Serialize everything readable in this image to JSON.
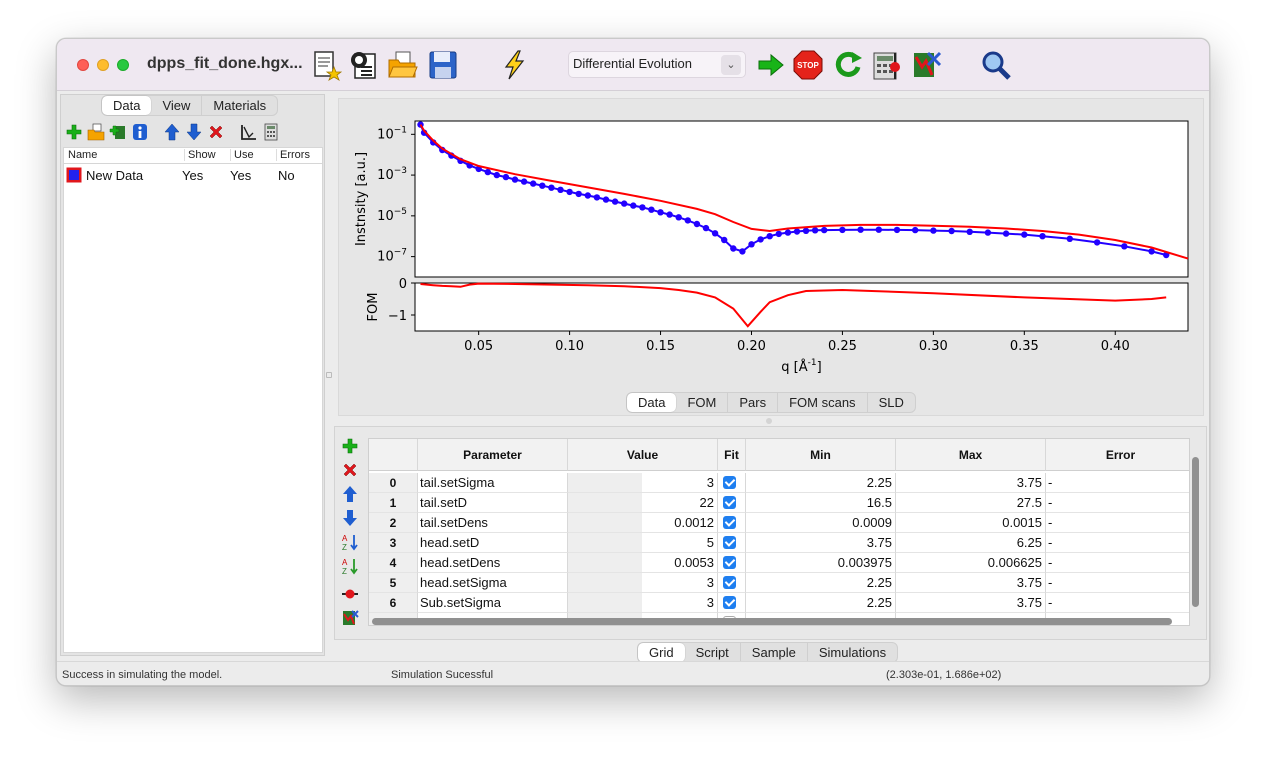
{
  "window": {
    "title": "dpps_fit_done.hgx..."
  },
  "toolbar": {
    "algorithm": "Differential Evolution",
    "icons": [
      "new-model-icon",
      "new-model-wizard-icon",
      "open-icon",
      "save-icon",
      "simulate-icon",
      "start-fit-icon",
      "stop-fit-icon",
      "restart-fit-icon",
      "calc-error-icon",
      "analyze-fit-icon",
      "zoom-icon"
    ]
  },
  "left": {
    "tabs": [
      "Data",
      "View",
      "Materials"
    ],
    "columns": {
      "name": "Name",
      "show": "Show",
      "use": "Use",
      "errors": "Errors"
    },
    "rows": [
      {
        "name": "New Data",
        "show": "Yes",
        "use": "Yes",
        "errors": "No",
        "color": "#2222ee"
      }
    ]
  },
  "plot_tabs": [
    "Data",
    "FOM",
    "Pars",
    "FOM scans",
    "SLD"
  ],
  "grid_tabs": [
    "Grid",
    "Script",
    "Sample",
    "Simulations"
  ],
  "grid": {
    "headers": {
      "index": "",
      "parameter": "Parameter",
      "value": "Value",
      "fit": "Fit",
      "min": "Min",
      "max": "Max",
      "error": "Error"
    },
    "rows": [
      {
        "i": "0",
        "p": "tail.setSigma",
        "v": "3",
        "min": "2.25",
        "max": "3.75",
        "e": "-"
      },
      {
        "i": "1",
        "p": "tail.setD",
        "v": "22",
        "min": "16.5",
        "max": "27.5",
        "e": "-"
      },
      {
        "i": "2",
        "p": "tail.setDens",
        "v": "0.0012",
        "min": "0.0009",
        "max": "0.0015",
        "e": "-"
      },
      {
        "i": "3",
        "p": "head.setD",
        "v": "5",
        "min": "3.75",
        "max": "6.25",
        "e": "-"
      },
      {
        "i": "4",
        "p": "head.setDens",
        "v": "0.0053",
        "min": "0.003975",
        "max": "0.006625",
        "e": "-"
      },
      {
        "i": "5",
        "p": "head.setSigma",
        "v": "3",
        "min": "2.25",
        "max": "3.75",
        "e": "-"
      },
      {
        "i": "6",
        "p": "Sub.setSigma",
        "v": "3",
        "min": "2.25",
        "max": "3.75",
        "e": "-"
      }
    ]
  },
  "status": {
    "left": "Success in simulating the model.",
    "center": "Simulation Sucessful",
    "right": "(2.303e-01, 1.686e+02)"
  },
  "chart_data": [
    {
      "type": "line",
      "ylabel": "Instnsity [a.u.]",
      "yscale": "log",
      "ytick_labels": [
        "10^{-1}",
        "10^{-3}",
        "10^{-5}",
        "10^{-7}"
      ],
      "xlim": [
        0.015,
        0.44
      ],
      "series": [
        {
          "color": "#2200ff",
          "markers": true,
          "x": [
            0.018,
            0.02,
            0.025,
            0.03,
            0.035,
            0.04,
            0.045,
            0.05,
            0.055,
            0.06,
            0.065,
            0.07,
            0.075,
            0.08,
            0.085,
            0.09,
            0.095,
            0.1,
            0.105,
            0.11,
            0.115,
            0.12,
            0.125,
            0.13,
            0.135,
            0.14,
            0.145,
            0.15,
            0.155,
            0.16,
            0.165,
            0.17,
            0.175,
            0.18,
            0.185,
            0.19,
            0.195,
            0.2,
            0.205,
            0.21,
            0.215,
            0.22,
            0.225,
            0.23,
            0.235,
            0.24,
            0.25,
            0.26,
            0.27,
            0.28,
            0.29,
            0.3,
            0.31,
            0.32,
            0.33,
            0.34,
            0.35,
            0.36,
            0.375,
            0.39,
            0.405,
            0.42,
            0.428
          ],
          "y": [
            0.3,
            0.12,
            0.04,
            0.017,
            0.009,
            0.005,
            0.003,
            0.002,
            0.0014,
            0.001,
            0.0008,
            0.0006,
            0.00048,
            0.00038,
            0.0003,
            0.00024,
            0.00019,
            0.00015,
            0.00012,
            0.0001,
            8e-05,
            6.3e-05,
            5e-05,
            4e-05,
            3.2e-05,
            2.6e-05,
            2e-05,
            1.5e-05,
            1.15e-05,
            8.5e-06,
            6e-06,
            4e-06,
            2.5e-06,
            1.4e-06,
            6.5e-07,
            2.5e-07,
            1.8e-07,
            4e-07,
            7e-07,
            1e-06,
            1.3e-06,
            1.5e-06,
            1.7e-06,
            1.85e-06,
            1.95e-06,
            2e-06,
            2.05e-06,
            2.1e-06,
            2.1e-06,
            2.05e-06,
            2e-06,
            1.9e-06,
            1.8e-06,
            1.65e-06,
            1.5e-06,
            1.35e-06,
            1.2e-06,
            1e-06,
            7.5e-07,
            5e-07,
            3.2e-07,
            1.8e-07,
            1.2e-07
          ]
        },
        {
          "color": "#ff0000",
          "markers": false,
          "x": [
            0.018,
            0.02,
            0.025,
            0.03,
            0.04,
            0.05,
            0.07,
            0.09,
            0.11,
            0.13,
            0.15,
            0.17,
            0.18,
            0.19,
            0.2,
            0.21,
            0.22,
            0.24,
            0.26,
            0.28,
            0.3,
            0.32,
            0.34,
            0.36,
            0.38,
            0.4,
            0.42,
            0.44
          ],
          "y": [
            0.3,
            0.15,
            0.05,
            0.02,
            0.006,
            0.0028,
            0.0011,
            0.00052,
            0.00025,
            0.00012,
            5.5e-05,
            2.2e-05,
            1.2e-05,
            5e-06,
            2.3e-06,
            1.8e-06,
            2.4e-06,
            3.2e-06,
            3.6e-06,
            3.6e-06,
            3.3e-06,
            2.9e-06,
            2.4e-06,
            1.8e-06,
            1.2e-06,
            6.5e-07,
            2.8e-07,
            8e-08
          ]
        }
      ]
    },
    {
      "type": "line",
      "ylabel": "FOM",
      "xlabel": "q [Å^{-1}]",
      "ylim": [
        -1.5,
        0
      ],
      "ytick_labels": [
        "0",
        "−1"
      ],
      "xtick_labels": [
        "0.05",
        "0.10",
        "0.15",
        "0.20",
        "0.25",
        "0.30",
        "0.35",
        "0.40"
      ],
      "xlim": [
        0.015,
        0.44
      ],
      "series": [
        {
          "color": "#ff0000",
          "x": [
            0.018,
            0.025,
            0.03,
            0.035,
            0.04,
            0.045,
            0.05,
            0.07,
            0.09,
            0.11,
            0.13,
            0.15,
            0.16,
            0.17,
            0.18,
            0.19,
            0.198,
            0.205,
            0.21,
            0.22,
            0.23,
            0.25,
            0.3,
            0.35,
            0.4,
            0.42,
            0.428
          ],
          "y": [
            -0.03,
            -0.07,
            -0.09,
            -0.1,
            -0.12,
            -0.05,
            -0.02,
            -0.03,
            -0.05,
            -0.07,
            -0.1,
            -0.16,
            -0.22,
            -0.3,
            -0.45,
            -0.8,
            -1.35,
            -0.9,
            -0.6,
            -0.38,
            -0.25,
            -0.22,
            -0.32,
            -0.45,
            -0.55,
            -0.5,
            -0.45
          ]
        }
      ]
    }
  ]
}
